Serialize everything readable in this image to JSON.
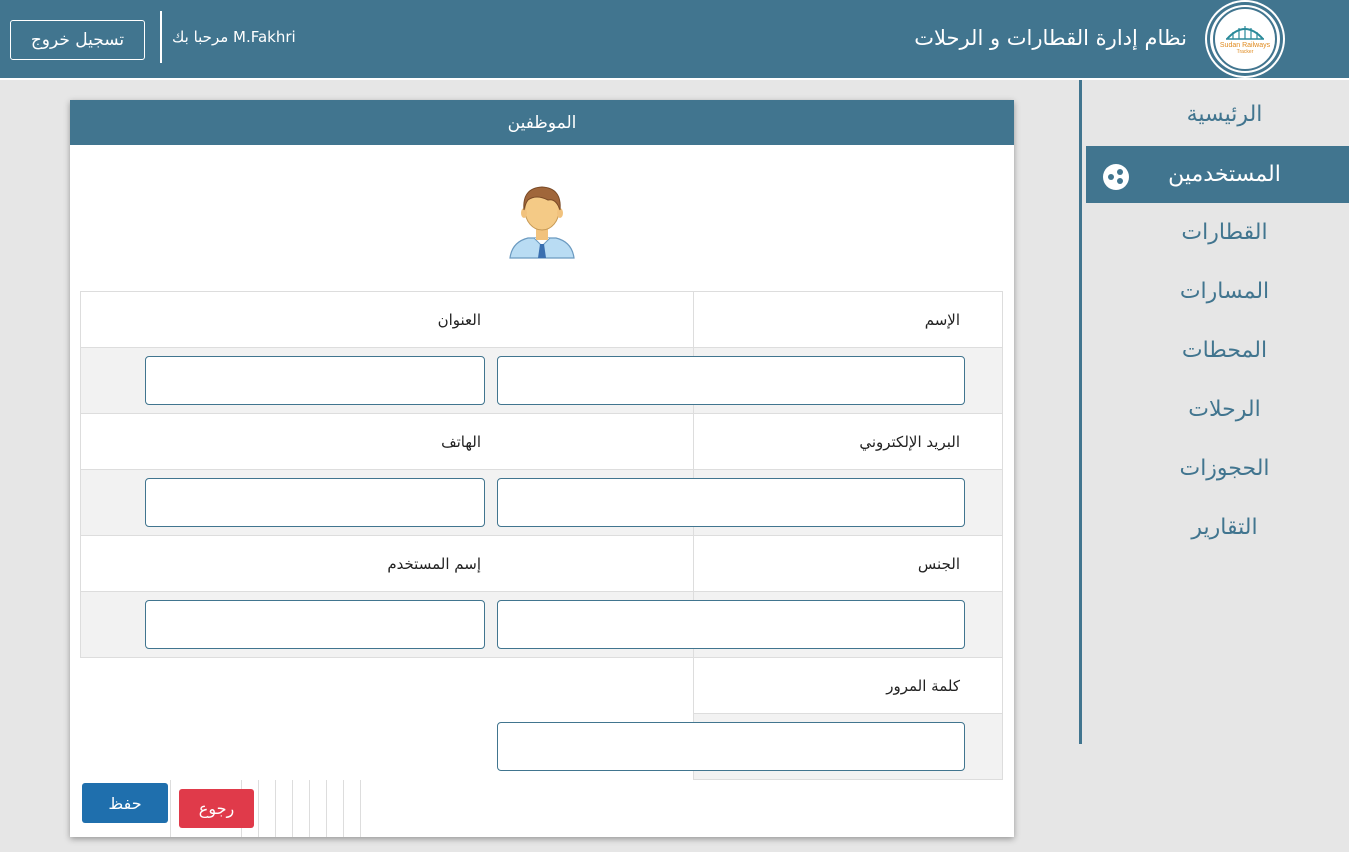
{
  "header": {
    "app_title": "نظام إدارة القطارات و الرحلات",
    "welcome": "مرحبا بك M.Fakhri",
    "logout_label": "تسجيل خروج",
    "logo_text": "Sudan Railways",
    "logo_sub": "Tracker"
  },
  "sidebar": {
    "items": [
      {
        "label": "الرئيسية",
        "active": false
      },
      {
        "label": "المستخدمين",
        "active": true
      },
      {
        "label": "القطارات",
        "active": false
      },
      {
        "label": "المسارات",
        "active": false
      },
      {
        "label": "المحطات",
        "active": false
      },
      {
        "label": "الرحلات",
        "active": false
      },
      {
        "label": "الحجوزات",
        "active": false
      },
      {
        "label": "التقارير",
        "active": false
      }
    ]
  },
  "panel": {
    "title": "الموظفين",
    "avatar_icon": "user-avatar-icon",
    "fields": {
      "name": {
        "label": "الإسم",
        "value": ""
      },
      "address": {
        "label": "العنوان",
        "value": ""
      },
      "email": {
        "label": "البريد الإلكتروني",
        "value": ""
      },
      "phone": {
        "label": "الهاتف",
        "value": ""
      },
      "gender": {
        "label": "الجنس",
        "value": ""
      },
      "username": {
        "label": "إسم المستخدم",
        "value": ""
      },
      "password": {
        "label": "كلمة المرور",
        "value": ""
      }
    },
    "save_label": "حفظ",
    "back_label": "رجوع"
  },
  "colors": {
    "primary": "#41758f",
    "save": "#1f6fad",
    "back": "#e03a4a",
    "background": "#e6e6e6"
  }
}
